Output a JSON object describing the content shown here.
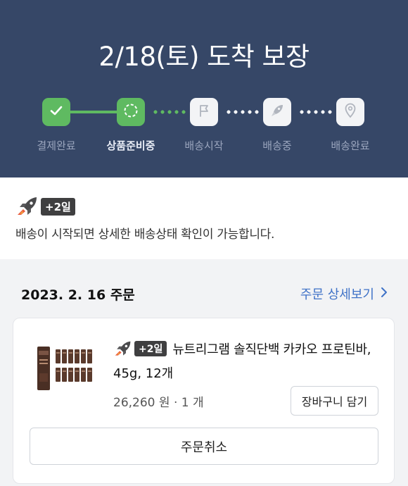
{
  "header": {
    "title": "2/18(토) 도착 보장",
    "steps": [
      {
        "label": "결제완료",
        "state": "done",
        "icon": "check-icon"
      },
      {
        "label": "상품준비중",
        "state": "current",
        "icon": "loading-circle-icon"
      },
      {
        "label": "배송시작",
        "state": "pending",
        "icon": "flag-icon"
      },
      {
        "label": "배송중",
        "state": "pending",
        "icon": "rocket-icon"
      },
      {
        "label": "배송완료",
        "state": "pending",
        "icon": "location-pin-icon"
      }
    ],
    "colors": {
      "background": "#364767",
      "done": "#5fba61"
    }
  },
  "delivery_info": {
    "badge": "+2일",
    "message": "배송이 시작되면 상세한 배송상태 확인이 가능합니다."
  },
  "order": {
    "date_label": "2023. 2. 16 주문",
    "detail_link": "주문 상세보기",
    "product": {
      "badge": "+2일",
      "name_line1": "뉴트리그램 솔직단백 카카오 프로틴바,",
      "name_line2": "45g, 12개",
      "price": "26,260 원",
      "quantity": "1 개",
      "cart_button": "장바구니 담기"
    },
    "cancel_button": "주문취소"
  }
}
